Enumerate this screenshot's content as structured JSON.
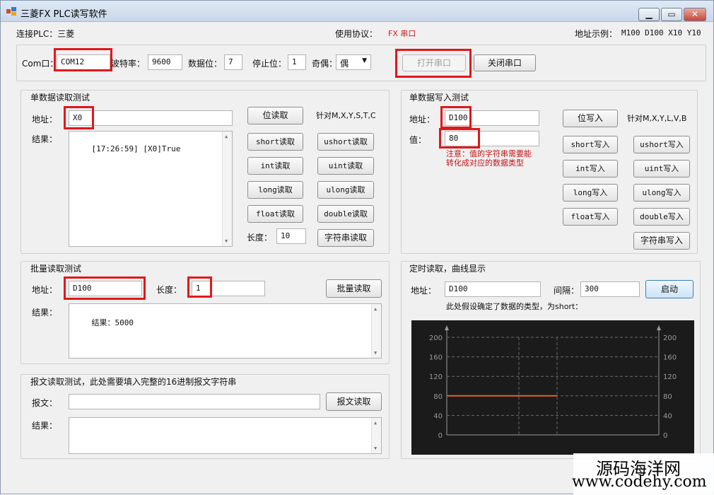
{
  "window": {
    "title": "三菱FX PLC读写软件",
    "minimize": "▁",
    "maximize": "▭",
    "close": "✕"
  },
  "header": {
    "plc_label": "连接PLC：三菱",
    "protocol_label": "使用协议：",
    "protocol_value": "FX 串口",
    "address_example_label": "地址示例：",
    "address_example_value": "M100 D100 X10 Y10"
  },
  "serial": {
    "com_label": "Com口：",
    "com_value": "COM12",
    "baud_label": "波特率：",
    "baud_value": "9600",
    "databits_label": "数据位：",
    "databits_value": "7",
    "stopbits_label": "停止位：",
    "stopbits_value": "1",
    "parity_label": "奇偶：",
    "parity_value": "偶",
    "open_button": "打开串口",
    "close_button": "关闭串口"
  },
  "single_read": {
    "title": "单数据读取测试",
    "address_label": "地址：",
    "address_value": "X0",
    "result_label": "结果：",
    "result_value": "[17:26:59] [X0]True",
    "bit_read": "位读取",
    "bit_note": "针对M,X,Y,S,T,C",
    "short_read": "short读取",
    "ushort_read": "ushort读取",
    "int_read": "int读取",
    "uint_read": "uint读取",
    "long_read": "long读取",
    "ulong_read": "ulong读取",
    "float_read": "float读取",
    "double_read": "double读取",
    "length_label": "长度：",
    "length_value": "10",
    "string_read": "字符串读取"
  },
  "single_write": {
    "title": "单数据写入测试",
    "address_label": "地址：",
    "address_value": "D100",
    "value_label": "值：",
    "value_value": "80",
    "note_line1": "注意：值的字符串需要能",
    "note_line2": "转化成对应的数据类型",
    "bit_write": "位写入",
    "bit_note": "针对M,X,Y,L,V,B",
    "short_write": "short写入",
    "ushort_write": "ushort写入",
    "int_write": "int写入",
    "uint_write": "uint写入",
    "long_write": "long写入",
    "ulong_write": "ulong写入",
    "float_write": "float写入",
    "double_write": "double写入",
    "string_write": "字符串写入"
  },
  "batch_read": {
    "title": "批量读取测试",
    "address_label": "地址：",
    "address_value": "D100",
    "length_label": "长度：",
    "length_value": "1",
    "button": "批量读取",
    "result_label": "结果：",
    "result_value": "结果：5000"
  },
  "message_read": {
    "title": "报文读取测试，此处需要填入完整的16进制报文字符串",
    "message_label": "报文：",
    "message_value": "",
    "button": "报文读取",
    "result_label": "结果：",
    "result_value": ""
  },
  "timed_read": {
    "title": "定时读取，曲线显示",
    "address_label": "地址：",
    "address_value": "D100",
    "interval_label": "间隔：",
    "interval_value": "300",
    "start_button": "启动",
    "note": "此处假设确定了数据的类型，为short："
  },
  "chart_data": {
    "type": "line",
    "ylim": [
      0,
      200
    ],
    "yticks": [
      0,
      40,
      80,
      120,
      160,
      200
    ],
    "series": [
      {
        "values": [
          80,
          80,
          80,
          80,
          80,
          80
        ]
      }
    ],
    "grid": true,
    "line_color": "#e0621e",
    "background": "#1b1b1b"
  },
  "watermark": {
    "line1": "源码海洋网",
    "line2": "www.codehy.com"
  }
}
